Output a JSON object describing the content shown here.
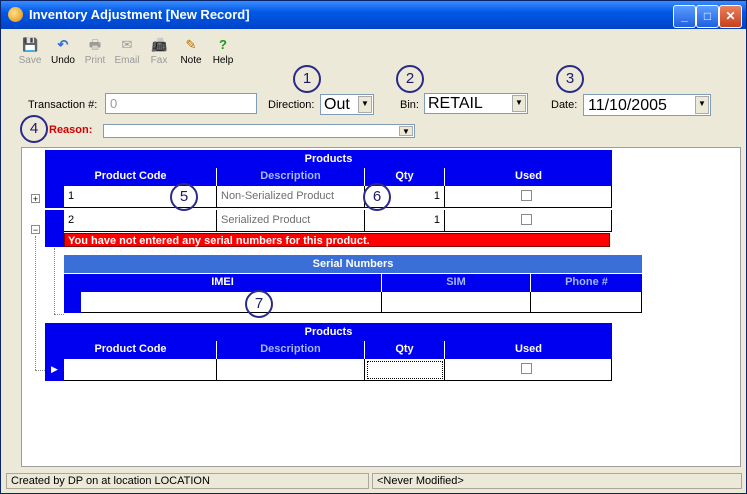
{
  "window": {
    "title": "Inventory Adjustment [New Record]",
    "min": "_",
    "max": "□",
    "close": "✕"
  },
  "toolbar": [
    {
      "label": "Save",
      "icon": "💾",
      "enabled": false
    },
    {
      "label": "Undo",
      "icon": "↶",
      "enabled": true
    },
    {
      "label": "Print",
      "icon": "🖶",
      "enabled": false
    },
    {
      "label": "Email",
      "icon": "✉",
      "enabled": false
    },
    {
      "label": "Fax",
      "icon": "📠",
      "enabled": false
    },
    {
      "label": "Note",
      "icon": "✎",
      "enabled": true
    },
    {
      "label": "Help",
      "icon": "?",
      "enabled": true
    }
  ],
  "form": {
    "transaction_label": "Transaction #:",
    "transaction_value": "0",
    "direction_label": "Direction:",
    "direction_value": "Out",
    "bin_label": "Bin:",
    "bin_value": "RETAIL",
    "date_label": "Date:",
    "date_value": "11/10/2005",
    "reason_label": "Reason:",
    "reason_value": ""
  },
  "callouts": [
    "1",
    "2",
    "3",
    "4",
    "5",
    "6",
    "7"
  ],
  "products_grid": {
    "title": "Products",
    "columns": [
      "Product Code",
      "Description",
      "Qty",
      "Used"
    ],
    "rows": [
      {
        "code": "1",
        "description": "Non-Serialized Product",
        "qty": "1",
        "used": false,
        "expander": "+"
      },
      {
        "code": "2",
        "description": "Serialized Product",
        "qty": "1",
        "used": false,
        "expander": "−",
        "error": "You have not entered any serial numbers for this product."
      }
    ]
  },
  "serial_grid": {
    "title": "Serial Numbers",
    "columns": [
      "IMEI",
      "SIM",
      "Phone #"
    ]
  },
  "products_grid_new": {
    "title": "Products",
    "columns": [
      "Product Code",
      "Description",
      "Qty",
      "Used"
    ]
  },
  "status": {
    "created": "Created by DP on  at location LOCATION",
    "modified": "<Never Modified>"
  }
}
